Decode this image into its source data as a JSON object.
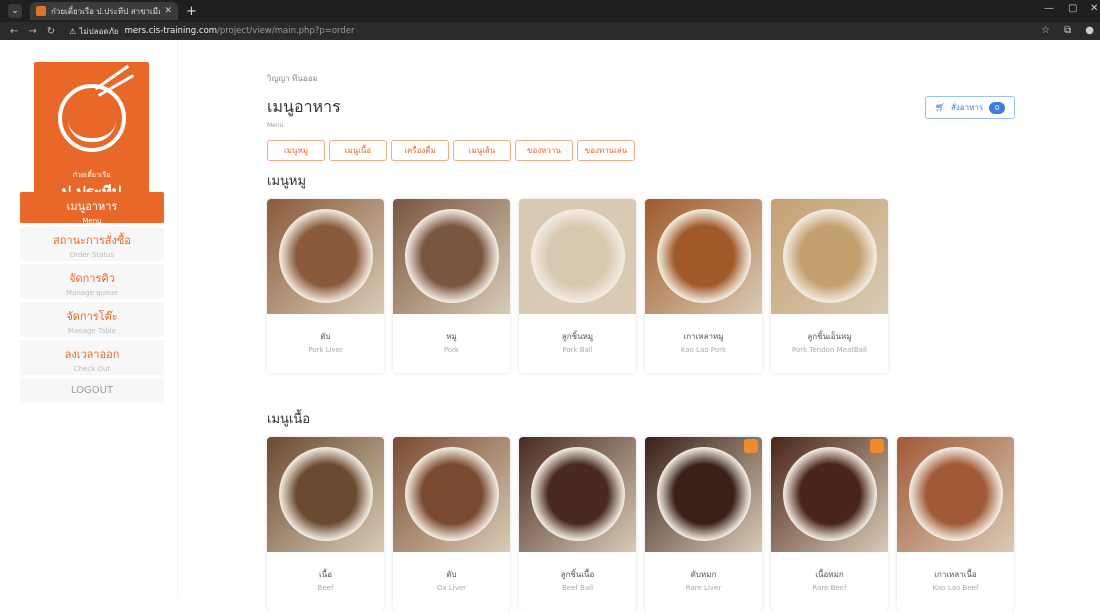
{
  "browser": {
    "tab_title": "ก๋วยเตี๋ยวเรือ ป.ประทีป สาขาเมืองนน",
    "url_warning": "ไม่ปลอดภัย",
    "url_host": "mers.cis-training.com",
    "url_path": "/project/view/main.php?p=order"
  },
  "sidebar": {
    "logo_small": "ก๋วยเตี๋ยวเรือ",
    "logo_name": "ป.ประทีป",
    "items": [
      {
        "th": "เมนูอาหาร",
        "en": "Menu"
      },
      {
        "th": "สถานะการสั่งซื้อ",
        "en": "Order Status"
      },
      {
        "th": "จัดการคิว",
        "en": "Manage queue"
      },
      {
        "th": "จัดการโต๊ะ",
        "en": "Manage Table"
      },
      {
        "th": "ลงเวลาออก",
        "en": "Check Out"
      },
      {
        "th": "LOGOUT",
        "en": ""
      }
    ]
  },
  "main": {
    "user": "วิญญา ทีนออม",
    "title": "เมนูอาหาร",
    "subtitle": "Menu",
    "order_button": "สั่งอาหาร",
    "order_count": "0",
    "categories": [
      "เมนูหมู",
      "เมนูเนื้อ",
      "เครื่องดื่ม",
      "เมนูเส้น",
      "ของหวาน",
      "ของทานเล่น"
    ],
    "sections": [
      {
        "title": "เมนูหมู",
        "items": [
          {
            "th": "ตับ",
            "en": "Pork Liver",
            "color": "#8a5a3c"
          },
          {
            "th": "หมู",
            "en": "Pork",
            "color": "#7a5540"
          },
          {
            "th": "ลูกชิ้นหมู",
            "en": "Pork Ball",
            "color": "#d8c8b0"
          },
          {
            "th": "เกาเหลาหมู",
            "en": "Kao Lao Pork",
            "color": "#a05a2a"
          },
          {
            "th": "ลูกชิ้นเอ็นหมู",
            "en": "Pork Tendon MeatBall",
            "color": "#c4a070"
          }
        ]
      },
      {
        "title": "เมนูเนื้อ",
        "items": [
          {
            "th": "เนื้อ",
            "en": "Beef",
            "color": "#6a4a30"
          },
          {
            "th": "ตับ",
            "en": "Ox Liver",
            "color": "#7a4a30"
          },
          {
            "th": "ลูกชิ้นเนื้อ",
            "en": "Beef Ball",
            "color": "#4a2a20"
          },
          {
            "th": "ตับหมก",
            "en": "Rare Liver",
            "color": "#3a2018"
          },
          {
            "th": "เนื้อหมก",
            "en": "Rare Beef",
            "color": "#4a2418"
          },
          {
            "th": "เกาเหลาเนื้อ",
            "en": "Kao Lao Beef",
            "color": "#a05a38"
          }
        ]
      }
    ]
  }
}
